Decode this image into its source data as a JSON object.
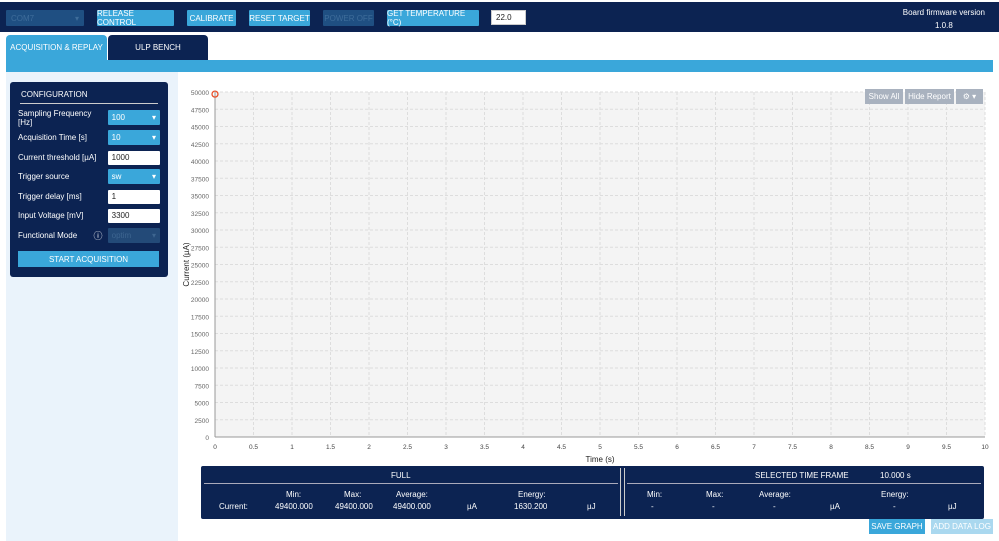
{
  "toolbar": {
    "port": "COM7",
    "release": "RELEASE CONTROL",
    "calibrate": "CALIBRATE",
    "reset": "RESET TARGET",
    "power": "POWER OFF",
    "temp": "GET TEMPERATURE (°C)",
    "temp_value": "22.0",
    "fw_label": "Board firmware version",
    "fw_version": "1.0.8"
  },
  "tabs": [
    "ACQUISITION & REPLAY",
    "ULP BENCH"
  ],
  "config": {
    "title": "CONFIGURATION",
    "fields": [
      {
        "label": "Sampling Frequency [Hz]",
        "value": "100"
      },
      {
        "label": "Acquisition Time [s]",
        "value": "10"
      },
      {
        "label": "Current threshold [µA]",
        "value": "1000"
      },
      {
        "label": "Trigger source",
        "value": "sw"
      },
      {
        "label": "Trigger delay [ms]",
        "value": "1"
      },
      {
        "label": "Input Voltage [mV]",
        "value": "3300"
      },
      {
        "label": "Functional Mode",
        "value": "optim"
      }
    ],
    "start": "START ACQUISITION"
  },
  "graph_buttons": {
    "show_all": "Show All",
    "hide_report": "Hide Report"
  },
  "chart_data": {
    "type": "scatter",
    "xlabel": "Time (s)",
    "ylabel": "Current (µA)",
    "xlim": [
      0,
      10
    ],
    "ylim": [
      0,
      50000
    ],
    "x_step": 0.5,
    "y_step": 2500,
    "grid": true,
    "points": [
      {
        "x": 0,
        "y": 49400
      }
    ],
    "marker_color": "#e8502a"
  },
  "stats": {
    "full": "FULL",
    "selected": "SELECTED TIME FRAME",
    "selected_time": "10.000 s",
    "min": "Min:",
    "max": "Max:",
    "avg": "Average:",
    "energy": "Energy:",
    "row_label": "Current:",
    "full_min": "49400.000",
    "full_max": "49400.000",
    "full_avg": "49400.000",
    "unit_ua": "µA",
    "full_energy": "1630.200",
    "unit_uj": "µJ",
    "dash": "-"
  },
  "buttons": {
    "save": "SAVE GRAPH",
    "add_log": "ADD DATA LOG"
  }
}
